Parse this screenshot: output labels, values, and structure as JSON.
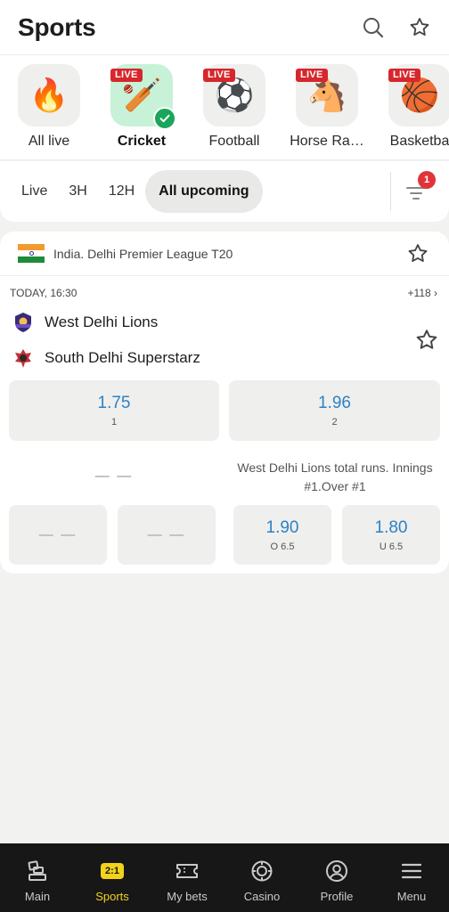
{
  "header": {
    "title": "Sports"
  },
  "sports": [
    {
      "label": "All live",
      "emoji": "🔥",
      "live": false,
      "active": false
    },
    {
      "label": "Cricket",
      "emoji": "🏏",
      "live": true,
      "active": true
    },
    {
      "label": "Football",
      "emoji": "⚽",
      "live": true,
      "active": false
    },
    {
      "label": "Horse Ra…",
      "emoji": "🐴",
      "live": true,
      "active": false
    },
    {
      "label": "Basketba",
      "emoji": "🏀",
      "live": true,
      "active": false
    }
  ],
  "live_badge": "LIVE",
  "filters": {
    "chips": [
      "Live",
      "3H",
      "12H",
      "All upcoming"
    ],
    "active": "All upcoming",
    "badge_count": "1"
  },
  "event": {
    "league": "India. Delhi Premier League T20",
    "time": "TODAY, 16:30",
    "more_markets": "+118 ›",
    "team1": "West Delhi Lions",
    "team2": "South Delhi Superstarz",
    "odds_main": [
      {
        "value": "1.75",
        "label": "1"
      },
      {
        "value": "1.96",
        "label": "2"
      }
    ],
    "market_left_placeholder": "— —",
    "market_title": "West Delhi Lions total runs. Innings #1.Over #1",
    "odds_secondary": [
      {
        "value": "— —",
        "label": ""
      },
      {
        "value": "— —",
        "label": ""
      },
      {
        "value": "1.90",
        "label": "O 6.5"
      },
      {
        "value": "1.80",
        "label": "U 6.5"
      }
    ]
  },
  "bottom_nav": [
    {
      "label": "Main",
      "icon": "main-icon"
    },
    {
      "label": "Sports",
      "icon": "score-icon",
      "icon_text": "2:1",
      "active": true
    },
    {
      "label": "My bets",
      "icon": "ticket-icon"
    },
    {
      "label": "Casino",
      "icon": "casino-chip-icon"
    },
    {
      "label": "Profile",
      "icon": "profile-icon"
    },
    {
      "label": "Menu",
      "icon": "hamburger-icon"
    }
  ],
  "colors": {
    "accent": "#f2d21b",
    "odds_blue": "#2d82c4",
    "live_red": "#d6272d",
    "check_green": "#1aa55a"
  }
}
